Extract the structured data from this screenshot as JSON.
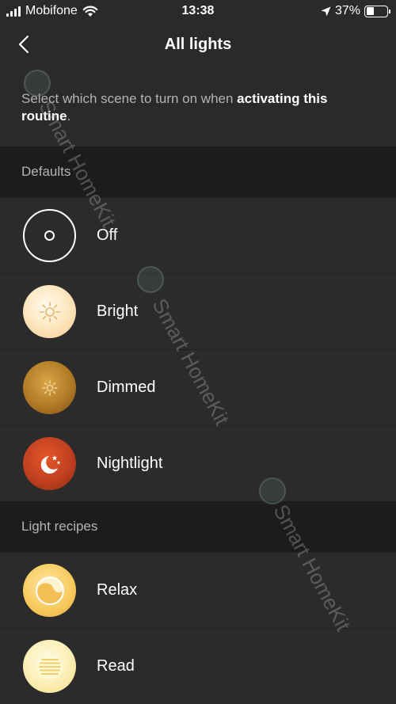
{
  "status_bar": {
    "carrier": "Mobifone",
    "time": "13:38",
    "battery_percent": "37%",
    "battery_level": 0.37,
    "icons": [
      "signal-icon",
      "wifi-icon",
      "location-arrow-icon",
      "battery-icon"
    ]
  },
  "nav": {
    "title": "All lights",
    "back_icon": "chevron-left-icon"
  },
  "intro": {
    "text_prefix": "Select which scene to turn on when ",
    "text_bold": "activating this routine",
    "text_suffix": "."
  },
  "sections": {
    "defaults": {
      "header": "Defaults",
      "items": [
        {
          "label": "Off",
          "icon": "off-icon"
        },
        {
          "label": "Bright",
          "icon": "sun-bright-icon"
        },
        {
          "label": "Dimmed",
          "icon": "sun-dim-icon"
        },
        {
          "label": "Nightlight",
          "icon": "moon-stars-icon"
        }
      ]
    },
    "recipes": {
      "header": "Light recipes",
      "items": [
        {
          "label": "Relax",
          "icon": "relax-icon"
        },
        {
          "label": "Read",
          "icon": "read-lines-icon"
        }
      ]
    }
  },
  "watermark": "Smart HomeKit",
  "colors": {
    "background": "#2a2a2a",
    "section_header": "#1c1c1c",
    "text_muted": "#b4b4b4"
  }
}
